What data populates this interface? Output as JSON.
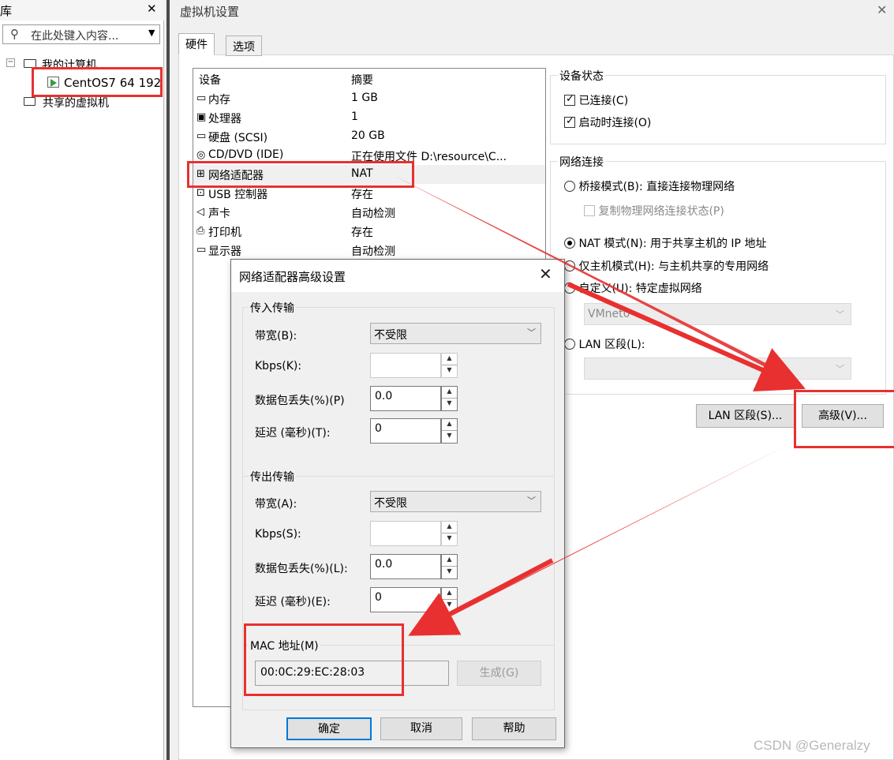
{
  "library": {
    "title": "库",
    "search_placeholder": "在此处键入内容...",
    "tree": [
      {
        "label": "我的计算机"
      },
      {
        "label": "CentOS7 64 192"
      },
      {
        "label": "共享的虚拟机"
      }
    ]
  },
  "window": {
    "title": "虚拟机设置",
    "tabs": [
      {
        "label": "硬件"
      },
      {
        "label": "选项"
      }
    ]
  },
  "device_list": {
    "headers": [
      "设备",
      "摘要"
    ],
    "rows": [
      {
        "name": "内存",
        "summary": "1 GB",
        "icon": "memory-icon"
      },
      {
        "name": "处理器",
        "summary": "1",
        "icon": "cpu-icon"
      },
      {
        "name": "硬盘 (SCSI)",
        "summary": "20 GB",
        "icon": "harddisk-icon"
      },
      {
        "name": "CD/DVD (IDE)",
        "summary": "正在使用文件 D:\\resource\\C...",
        "icon": "cd-icon"
      },
      {
        "name": "网络适配器",
        "summary": "NAT",
        "icon": "network-icon"
      },
      {
        "name": "USB 控制器",
        "summary": "存在",
        "icon": "usb-icon"
      },
      {
        "name": "声卡",
        "summary": "自动检测",
        "icon": "speaker-icon"
      },
      {
        "name": "打印机",
        "summary": "存在",
        "icon": "printer-icon"
      },
      {
        "name": "显示器",
        "summary": "自动检测",
        "icon": "monitor-icon"
      }
    ]
  },
  "device_status": {
    "title": "设备状态",
    "connected": "已连接(C)",
    "connect_on_power": "启动时连接(O)"
  },
  "network": {
    "title": "网络连接",
    "bridged": "桥接模式(B): 直接连接物理网络",
    "replicate": "复制物理网络连接状态(P)",
    "nat": "NAT 模式(N): 用于共享主机的 IP 地址",
    "hostonly": "仅主机模式(H): 与主机共享的专用网络",
    "custom": "自定义(U): 特定虚拟网络",
    "vmnet": "VMnet0",
    "lan": "LAN 区段(L):",
    "lan_btn": "LAN 区段(S)...",
    "adv_btn": "高级(V)..."
  },
  "dialog": {
    "title": "网络适配器高级设置",
    "incoming": {
      "title": "传入传输",
      "bandwidth_label": "带宽(B):",
      "bandwidth_value": "不受限",
      "kbps_label": "Kbps(K):",
      "kbps_value": "",
      "loss_label": "数据包丢失(%)(P)",
      "loss_value": "0.0",
      "latency_label": "延迟 (毫秒)(T):",
      "latency_value": "0"
    },
    "outgoing": {
      "title": "传出传输",
      "bandwidth_label": "带宽(A):",
      "bandwidth_value": "不受限",
      "kbps_label": "Kbps(S):",
      "kbps_value": "",
      "loss_label": "数据包丢失(%)(L):",
      "loss_value": "0.0",
      "latency_label": "延迟 (毫秒)(E):",
      "latency_value": "0"
    },
    "mac": {
      "title": "MAC 地址(M)",
      "value": "00:0C:29:EC:28:03",
      "generate": "生成(G)"
    },
    "buttons": {
      "ok": "确定",
      "cancel": "取消",
      "help": "帮助"
    }
  },
  "watermark": "CSDN @Generalzy",
  "colors": {
    "annotation_red": "#e83030",
    "selected_row": "#f0f0f0"
  }
}
